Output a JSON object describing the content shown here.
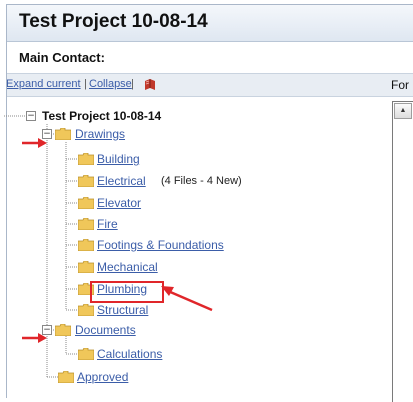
{
  "header": {
    "title": "Test Project 10-08-14"
  },
  "contact": {
    "label": "Main Contact:"
  },
  "toolbar": {
    "expand_label": "Expand current",
    "separator": "|",
    "collapse_label": "Collapse",
    "icon": "book-icon",
    "right_label": "For"
  },
  "tree": {
    "root": {
      "label": "Test Project 10-08-14",
      "toggle": "−"
    },
    "drawings": {
      "label": "Drawings",
      "toggle": "−",
      "children": {
        "building": "Building",
        "electrical": "Electrical",
        "electrical_note": "(4 Files - 4 New)",
        "elevator": "Elevator",
        "fire": "Fire",
        "footings": "Footings & Foundations",
        "mechanical": "Mechanical",
        "plumbing": "Plumbing",
        "structural": "Structural"
      }
    },
    "documents": {
      "label": "Documents",
      "toggle": "−",
      "children": {
        "calculations": "Calculations"
      }
    },
    "approved": {
      "label": "Approved"
    }
  },
  "annotations": {
    "arrow_color": "#e0262a",
    "highlight_color": "#e0262a"
  },
  "colors": {
    "link": "#3b5da8",
    "folder": "#f2c94c"
  }
}
